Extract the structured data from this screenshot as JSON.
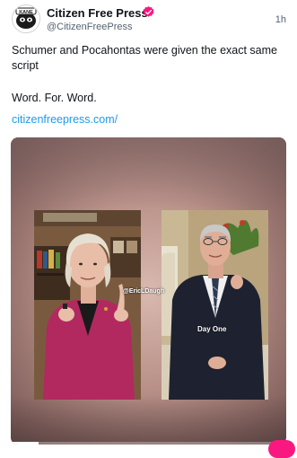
{
  "post": {
    "display_name": "Citizen Free Press",
    "handle": "@CitizenFreePress",
    "timestamp": "1h",
    "text_line1": "Schumer and Pocahontas were given the exact same script",
    "text_line2": "Word. For. Word.",
    "link": "citizenfreepress.com/"
  },
  "avatar": {
    "label": "KANE"
  },
  "video": {
    "watermark": "@EricLDaugh",
    "caption": "Day One",
    "progress": 0.1
  },
  "colors": {
    "verified": "#f91880",
    "link": "#1d9bf0",
    "action_button": "#f91880"
  }
}
